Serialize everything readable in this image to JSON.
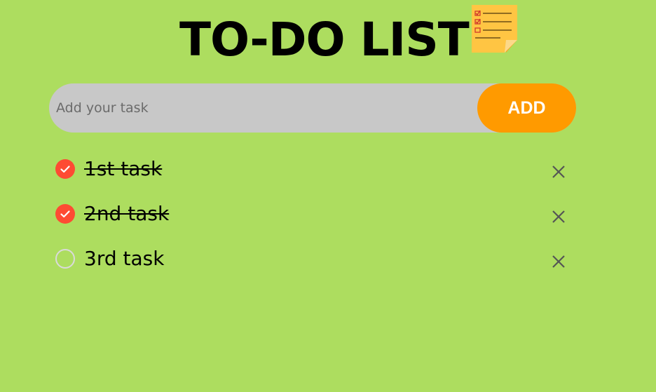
{
  "app": {
    "title": "TO-DO LIST",
    "title_icon": "sticky-note-checklist-icon"
  },
  "input": {
    "placeholder": "Add your task",
    "value": "",
    "add_label": "ADD"
  },
  "tasks": [
    {
      "label": "1st task",
      "done": true
    },
    {
      "label": "2nd task",
      "done": true
    },
    {
      "label": "3rd task",
      "done": false
    }
  ],
  "colors": {
    "background": "#addd5f",
    "input_background": "#c8c8c8",
    "add_button": "#ff9a00",
    "checked": "#fe4b33",
    "unchecked_border": "#dadada",
    "delete_icon": "#555555"
  }
}
